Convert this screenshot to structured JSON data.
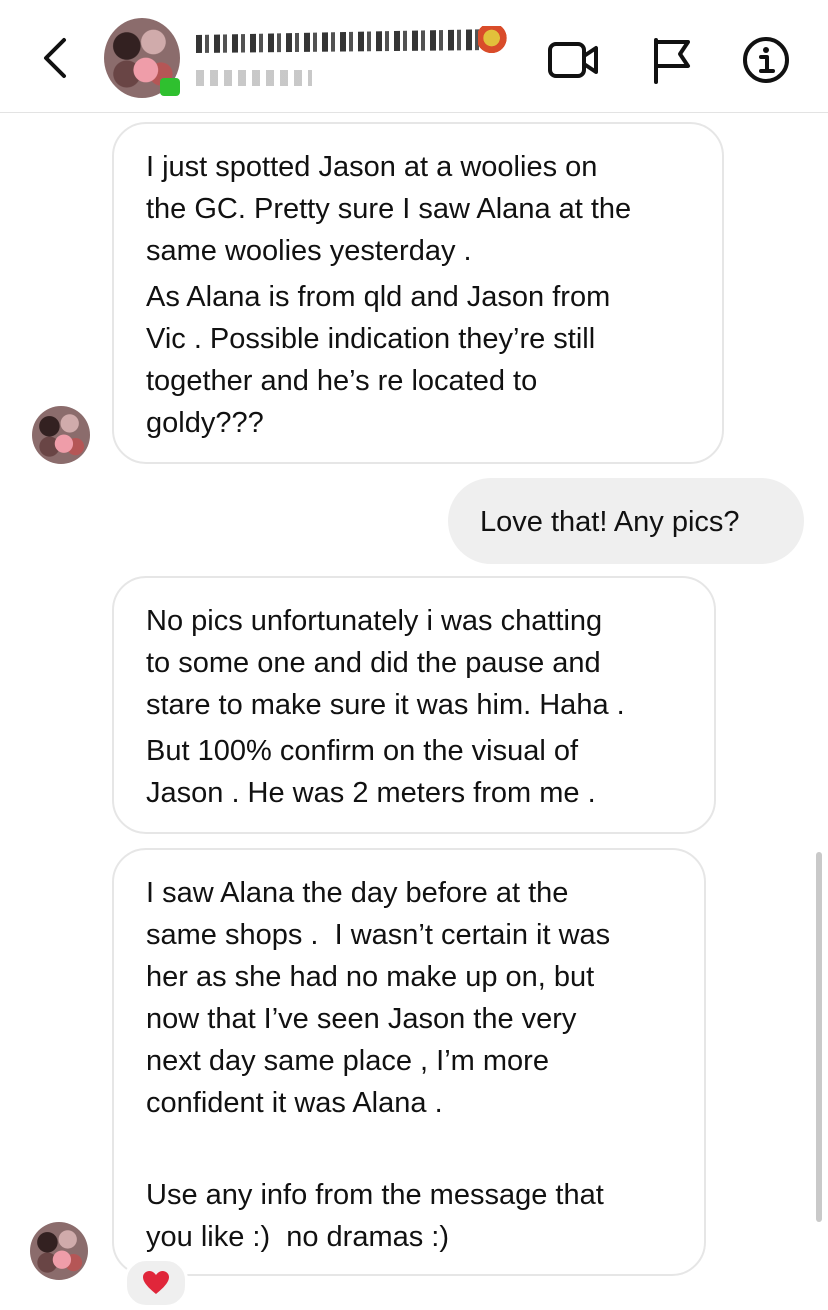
{
  "header": {
    "contact_name_obscured": true,
    "icons": [
      "back-chevron-icon",
      "video-call-icon",
      "flag-icon",
      "info-icon"
    ]
  },
  "messages": [
    {
      "side": "received",
      "paragraphs": [
        "I just spotted Jason at a woolies on\nthe GC. Pretty sure I saw Alana at the\nsame woolies yesterday .",
        "As Alana is from qld and Jason from\nVic . Possible indication they’re still\ntogether and he’s re located to\ngoldy???"
      ]
    },
    {
      "side": "sent",
      "text": "Love that! Any pics?"
    },
    {
      "side": "received",
      "paragraphs": [
        "No pics unfortunately i was chatting\nto some one and did the pause and\nstare to make sure it was him. Haha .",
        "But 100% confirm on the visual of\nJason . He was 2 meters from me ."
      ]
    },
    {
      "side": "received",
      "paragraphs": [
        "I saw Alana the day before at the\nsame shops .  I wasn’t certain it was\nher as she had no make up on, but\nnow that I’ve seen Jason the very\nnext day same place , I’m more\nconfident it was Alana .",
        "Use any info from the message that\nyou like :)  no dramas :)"
      ],
      "reaction": "❤️"
    }
  ],
  "colors": {
    "sent_bubble": "#efefef",
    "received_border": "#e6e6e6",
    "heart": "#e0263a"
  }
}
